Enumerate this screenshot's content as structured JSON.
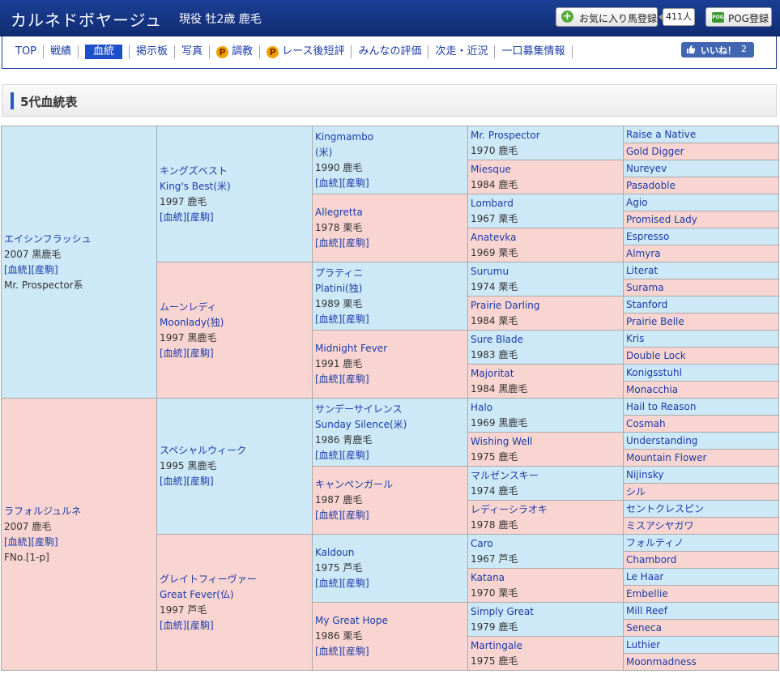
{
  "header": {
    "horse_name": "カルネドボヤージュ",
    "meta": "現役 牡2歳 鹿毛",
    "fav_label": "お気に入り馬登録",
    "fav_count": "411人",
    "pog_icon_text": "POG",
    "pog_label": "POG登録"
  },
  "nav": {
    "items": [
      "TOP",
      "戦績",
      "血統",
      "掲示板",
      "写真",
      "調教",
      "レース後短評",
      "みんなの評価",
      "次走・近況",
      "一口募集情報"
    ],
    "active": "血統",
    "p_badge": "P",
    "like_label": "いいね！",
    "like_count": "2"
  },
  "section": {
    "title": "5代血統表"
  },
  "links": {
    "blood": "[血統]",
    "produce": "[産駒]"
  },
  "pedigree": {
    "g1": [
      {
        "name": "エイシンフラッシュ",
        "info": "2007 黒鹿毛",
        "line": "Mr. Prospector系"
      },
      {
        "name": "ラフォルジュルネ",
        "info": "2007 鹿毛",
        "line": "FNo.[1-p]"
      }
    ],
    "g2": [
      {
        "name": "キングズベスト",
        "name2": "King's Best(米)",
        "info": "1997 鹿毛"
      },
      {
        "name": "ムーンレディ",
        "name2": "Moonlady(独)",
        "info": "1997 黒鹿毛"
      },
      {
        "name": "スペシャルウィーク",
        "name2": "",
        "info": "1995 黒鹿毛"
      },
      {
        "name": "グレイトフィーヴァー",
        "name2": "Great Fever(仏)",
        "info": "1997 芦毛"
      }
    ],
    "g3": [
      {
        "name": "Kingmambo",
        "name2": "(米)",
        "info": "1990 鹿毛"
      },
      {
        "name": "Allegretta",
        "name2": "",
        "info": "1978 栗毛"
      },
      {
        "name": "プラティニ",
        "name2": "Platini(独)",
        "info": "1989 栗毛"
      },
      {
        "name": "Midnight Fever",
        "name2": "",
        "info": "1991 鹿毛"
      },
      {
        "name": "サンデーサイレンス",
        "name2": "Sunday Silence(米)",
        "info": "1986 青鹿毛"
      },
      {
        "name": "キャンペンガール",
        "name2": "",
        "info": "1987 鹿毛"
      },
      {
        "name": "Kaldoun",
        "name2": "",
        "info": "1975 芦毛"
      },
      {
        "name": "My Great Hope",
        "name2": "",
        "info": "1986 栗毛"
      }
    ],
    "g4": [
      {
        "name": "Mr. Prospector",
        "info": "1970 鹿毛"
      },
      {
        "name": "Miesque",
        "info": "1984 鹿毛"
      },
      {
        "name": "Lombard",
        "info": "1967 栗毛"
      },
      {
        "name": "Anatevka",
        "info": "1969 栗毛"
      },
      {
        "name": "Surumu",
        "info": "1974 栗毛"
      },
      {
        "name": "Prairie Darling",
        "info": "1984 栗毛"
      },
      {
        "name": "Sure Blade",
        "info": "1983 鹿毛"
      },
      {
        "name": "Majoritat",
        "info": "1984 黒鹿毛"
      },
      {
        "name": "Halo",
        "info": "1969 黒鹿毛"
      },
      {
        "name": "Wishing Well",
        "info": "1975 鹿毛"
      },
      {
        "name": "マルゼンスキー",
        "info": "1974 鹿毛"
      },
      {
        "name": "レディーシラオキ",
        "info": "1978 鹿毛"
      },
      {
        "name": "Caro",
        "info": "1967 芦毛"
      },
      {
        "name": "Katana",
        "info": "1970 栗毛"
      },
      {
        "name": "Simply Great",
        "info": "1979 鹿毛"
      },
      {
        "name": "Martingale",
        "info": "1975 鹿毛"
      }
    ],
    "g5": [
      "Raise a Native",
      "Gold Digger",
      "Nureyev",
      "Pasadoble",
      "Agio",
      "Promised Lady",
      "Espresso",
      "Almyra",
      "Literat",
      "Surama",
      "Stanford",
      "Prairie Belle",
      "Kris",
      "Double Lock",
      "Konigsstuhl",
      "Monacchia",
      "Hail to Reason",
      "Cosmah",
      "Understanding",
      "Mountain Flower",
      "Nijinsky",
      "シル",
      "セントクレスピン",
      "ミスアシヤガワ",
      "フォルティノ",
      "Chambord",
      "Le Haar",
      "Embellie",
      "Mill Reef",
      "Seneca",
      "Luthier",
      "Moonmadness"
    ]
  }
}
